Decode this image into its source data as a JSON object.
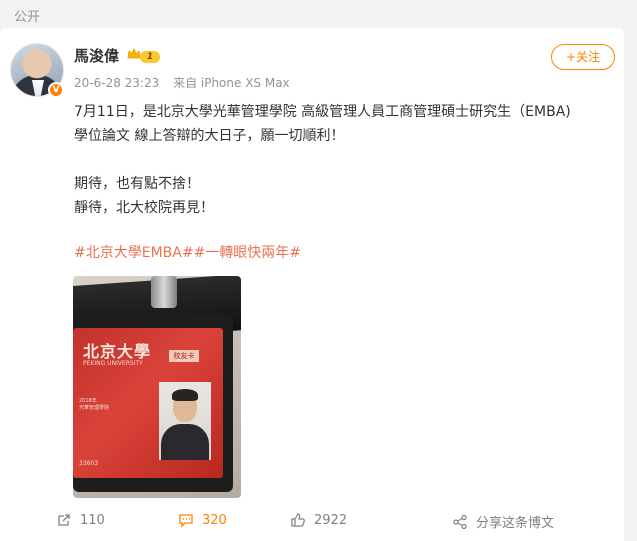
{
  "header": {
    "visibility_label": "公开"
  },
  "post": {
    "author": {
      "name": "馬浚偉",
      "level": "1",
      "avatar_icon": "user-avatar",
      "verified_icon": "verified-v-icon"
    },
    "timestamp": "20-6-28 23:23",
    "source": "来自 iPhone XS Max",
    "follow_label": "+关注",
    "text_lines": [
      "7月11日，是北京大學光華管理學院 高級管理人員工商管理碩士研究生（EMBA)",
      "學位論文 線上答辯的大日子，願一切順利！",
      "",
      "期待，也有點不捨！",
      "靜待，北大校院再見！"
    ],
    "hashtags": "#北京大學EMBA##一轉眼快兩年#",
    "image": {
      "card_title": "北京大學",
      "card_subtitle": "PEKING UNIVERSITY",
      "card_tag": "校友卡",
      "card_info": "2018年\n光華管理學院",
      "card_number": "33603"
    },
    "actions": {
      "repost": "110",
      "comment": "320",
      "like": "2922",
      "share": "分享这条博文"
    }
  },
  "colors": {
    "accent": "#ff8200",
    "hashtag": "#eb7350",
    "muted": "#939393"
  }
}
